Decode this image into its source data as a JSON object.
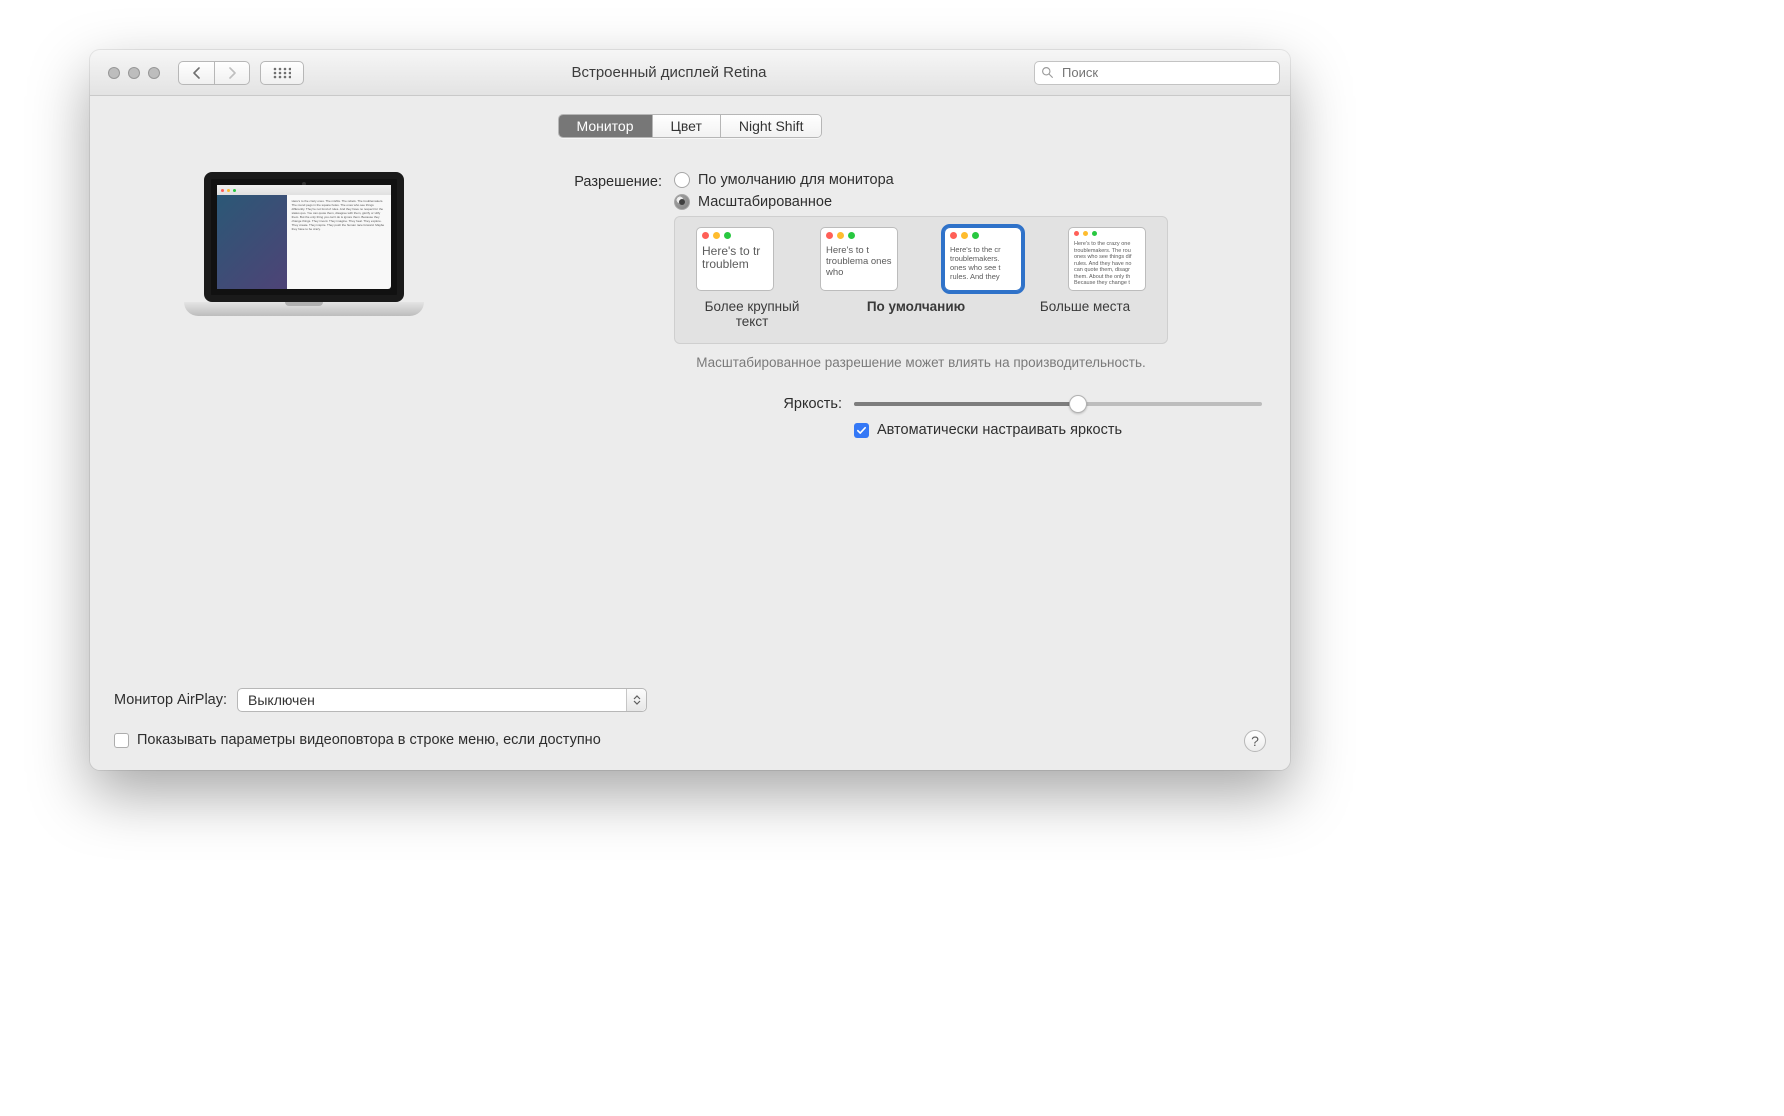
{
  "window": {
    "title": "Встроенный дисплей Retina"
  },
  "search": {
    "placeholder": "Поиск"
  },
  "tabs": {
    "monitor": "Монитор",
    "color": "Цвет",
    "nightshift": "Night Shift"
  },
  "resolution": {
    "label": "Разрешение:",
    "default": "По умолчанию для монитора",
    "scaled": "Масштабированное",
    "thumb_text_large": "Here's to tr troublem",
    "thumb_text_default": "Here's to t troublema ones who",
    "thumb_text_sel": "Here's to the cr troublemakers. ones who see t rules. And they",
    "thumb_text_more": "Here's to the crazy one troublemakers. The rou ones who see things dif rules. And they have no can quote them, disagr them. About the only th Because they change t",
    "label_large": "Более крупный текст",
    "label_default": "По умолчанию",
    "label_more": "Больше места",
    "warning": "Масштабированное разрешение может влиять на производительность."
  },
  "brightness": {
    "label": "Яркость:",
    "value_pct": 55,
    "auto": "Автоматически настраивать яркость"
  },
  "airplay": {
    "label": "Монитор AirPlay:",
    "value": "Выключен"
  },
  "mirroring": {
    "label": "Показывать параметры видеоповтора в строке меню, если доступно"
  },
  "help": {
    "label": "?"
  }
}
